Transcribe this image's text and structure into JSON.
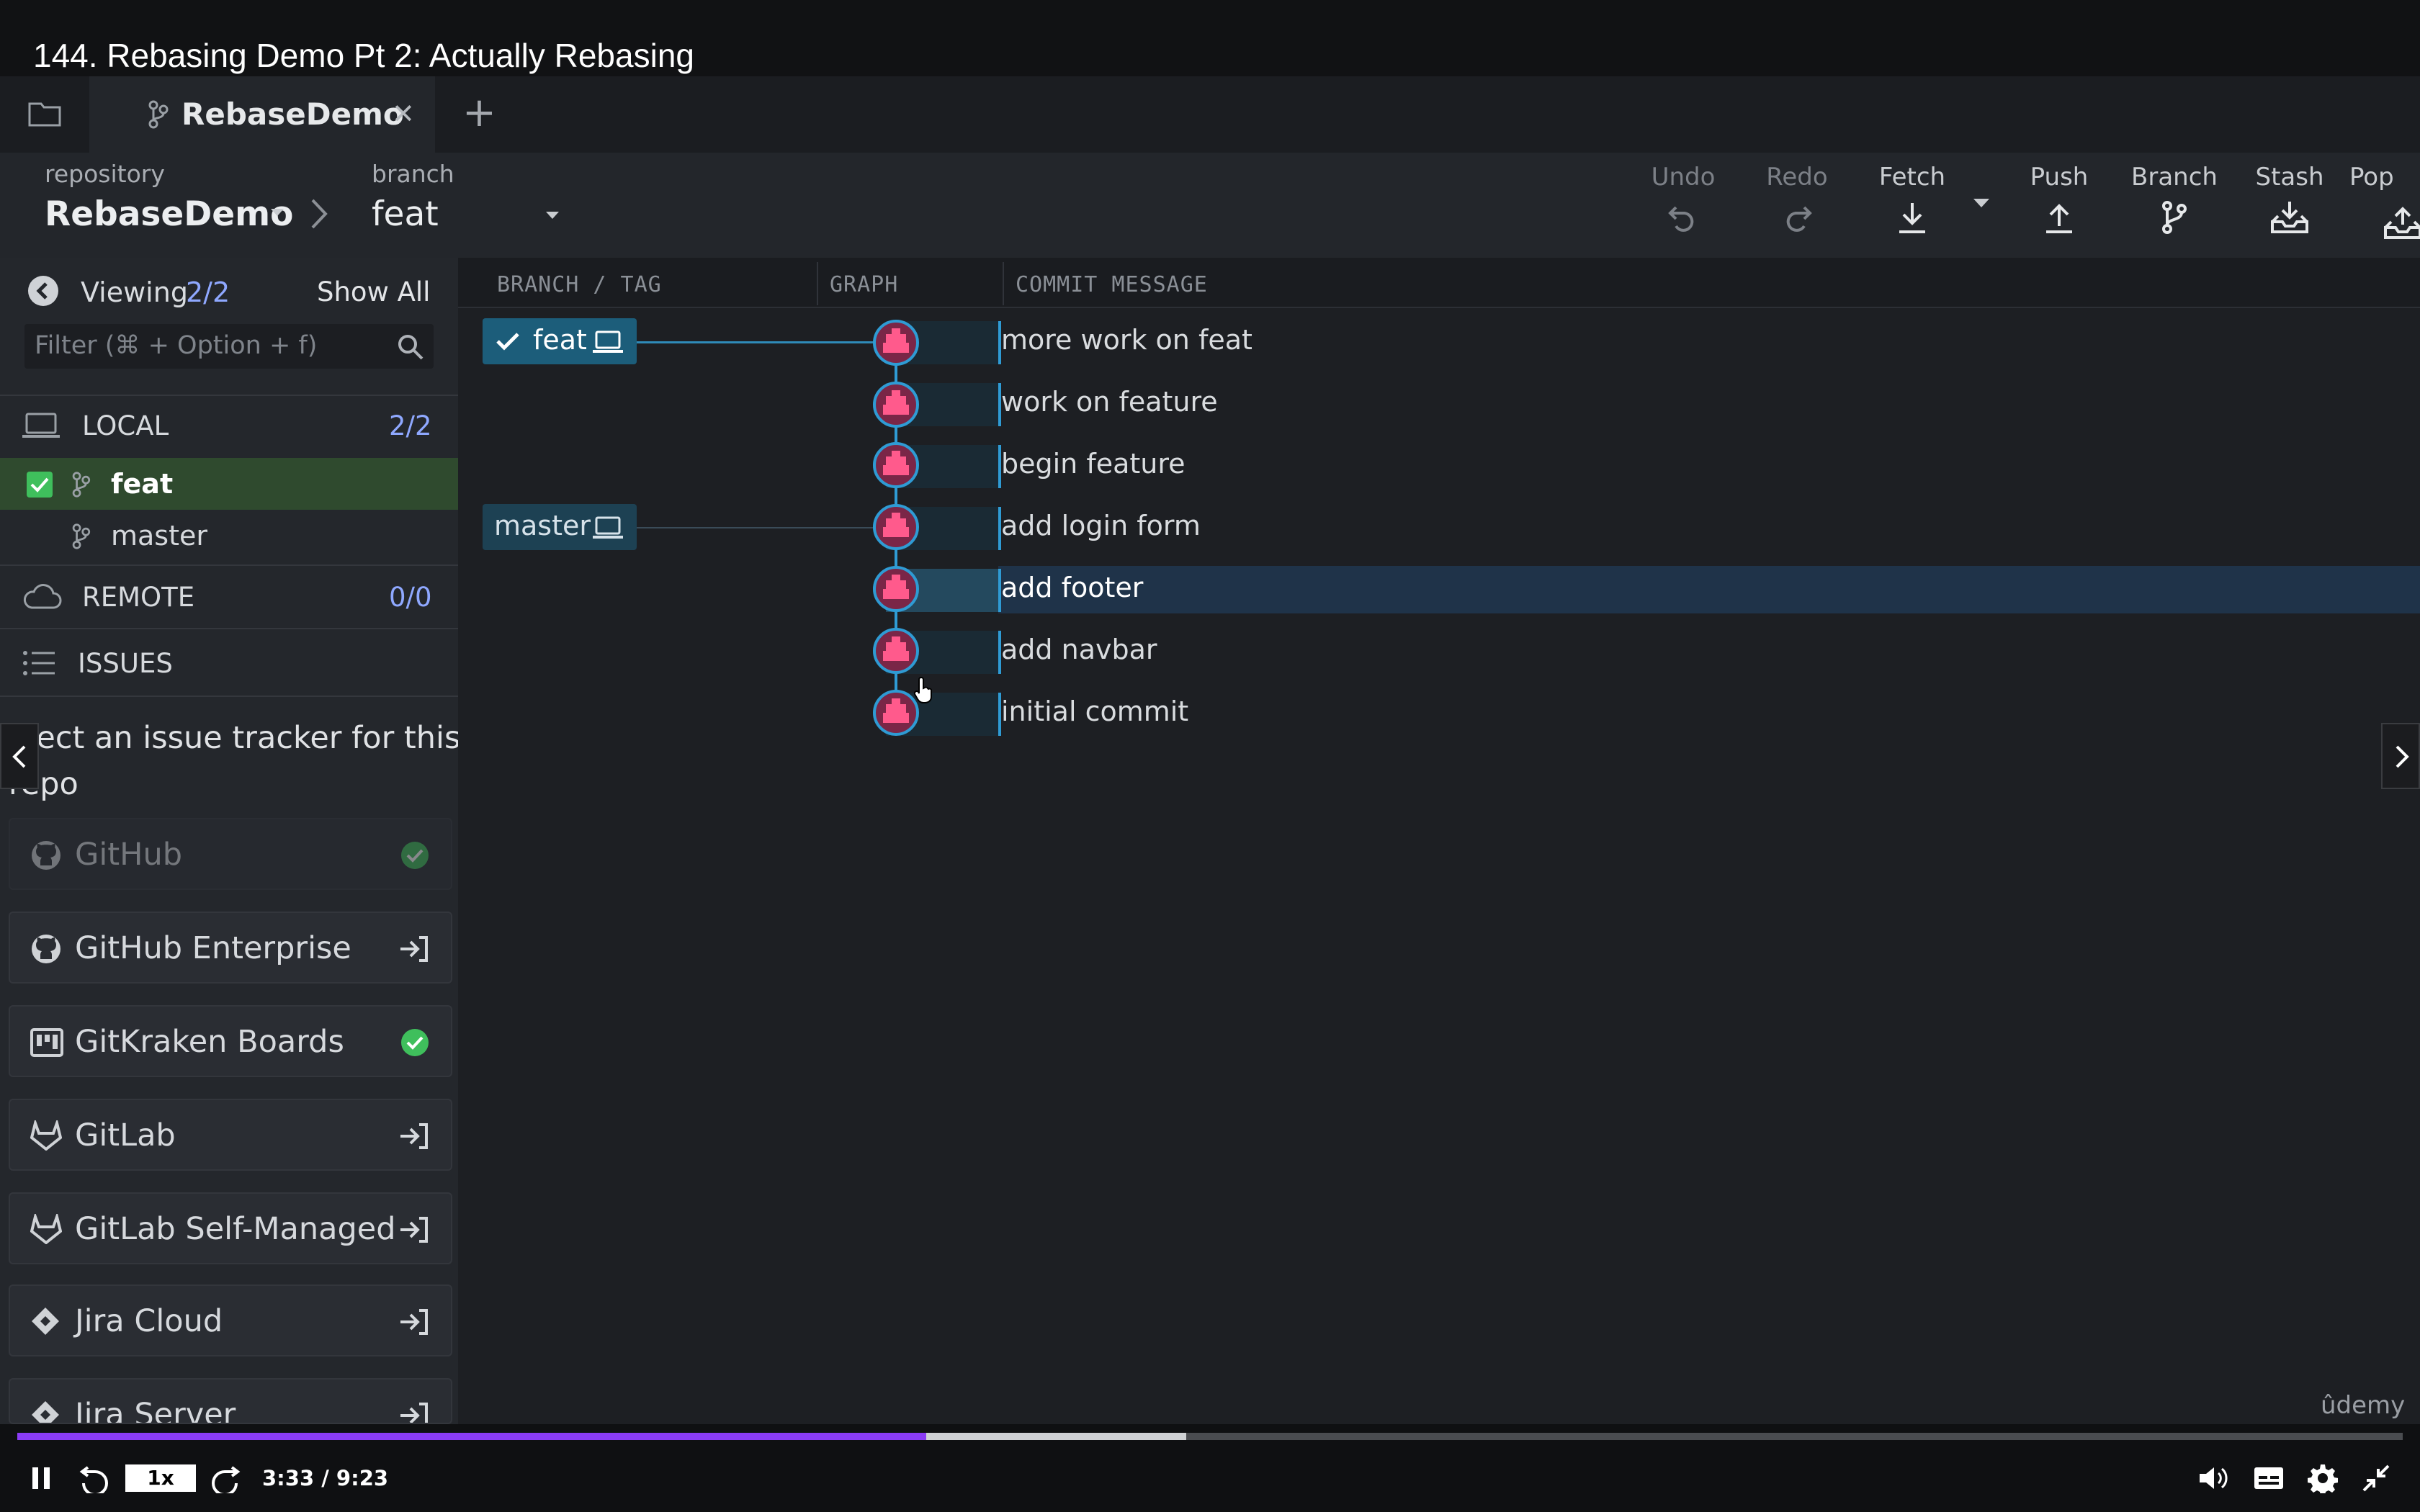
{
  "video": {
    "title": "144. Rebasing Demo Pt 2: Actually Rebasing",
    "time": "3:33 / 9:23",
    "speed": "1x",
    "progress": 0.381,
    "buffered": 0.49,
    "watermark": "ûdemy"
  },
  "tab": {
    "label": "RebaseDemo",
    "close": "✕",
    "add": "+"
  },
  "toolbar": {
    "repository_label": "repository",
    "repository_value": "RebaseDemo",
    "branch_label": "branch",
    "branch_value": "feat",
    "actions": [
      "Undo",
      "Redo",
      "Fetch",
      "Push",
      "Branch",
      "Stash",
      "Pop"
    ]
  },
  "sidebar": {
    "viewing_label": "Viewing",
    "viewing_count": "2/2",
    "show_all": "Show All",
    "filter_placeholder": "Filter (⌘ + Option + f)",
    "local_label": "LOCAL",
    "local_count": "2/2",
    "branches": [
      "feat",
      "master"
    ],
    "remote_label": "REMOTE",
    "remote_count": "0/0",
    "issues_label": "ISSUES",
    "issue_prompt_line1": "elect an issue tracker for this",
    "issue_prompt_line2": "repo",
    "trackers": [
      "GitHub",
      "GitHub Enterprise",
      "GitKraken Boards",
      "GitLab",
      "GitLab Self-Managed",
      "Jira Cloud",
      "Jira Server"
    ]
  },
  "graph": {
    "headers": {
      "branch": "BRANCH / TAG",
      "graph": "GRAPH",
      "message": "COMMIT MESSAGE"
    },
    "branch_tags": {
      "feat": "feat",
      "master": "master"
    },
    "commits": [
      "more work on feat",
      "work on feature",
      "begin feature",
      "add login form",
      "add footer",
      "add navbar",
      "initial commit"
    ],
    "selected_commit": "add footer"
  },
  "colors": {
    "accent": "#8b3cf6",
    "branch_tag": "#1c5d7a",
    "graph_line": "#2f9bd4",
    "avatar": "#e0447a",
    "selected_branch": "#2f4a2e"
  }
}
